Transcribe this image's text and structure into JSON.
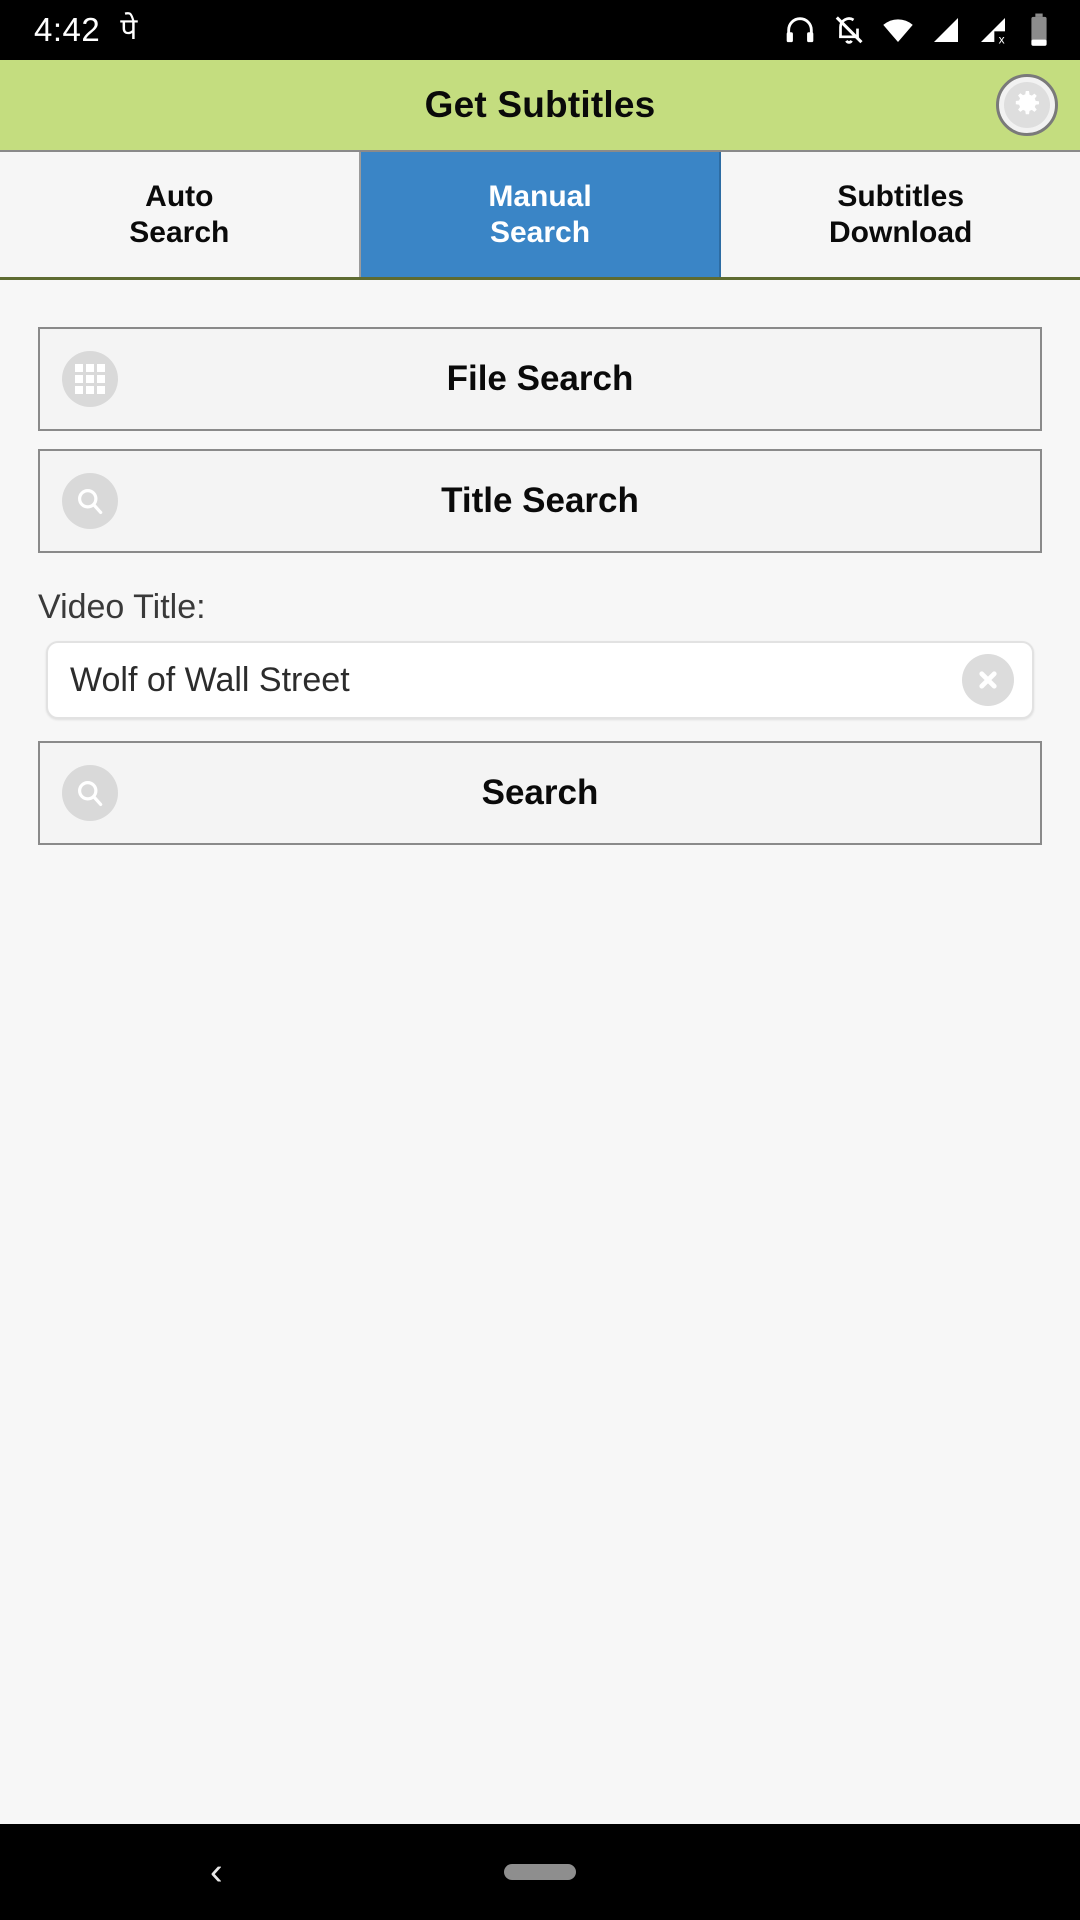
{
  "status_bar": {
    "clock": "4:42",
    "ime_glyph": "पे",
    "icons": [
      {
        "name": "headphones-icon"
      },
      {
        "name": "notifications-off-icon"
      },
      {
        "name": "wifi-icon"
      },
      {
        "name": "signal-bar-icon"
      },
      {
        "name": "signal-no-sim-icon"
      },
      {
        "name": "battery-icon"
      }
    ]
  },
  "header": {
    "title": "Get Subtitles",
    "background_color": "#c4dd7f",
    "settings_icon": "gear-icon"
  },
  "tabs": [
    {
      "line1": "Auto",
      "line2": "Search",
      "active": false
    },
    {
      "line1": "Manual",
      "line2": "Search",
      "active": true
    },
    {
      "line1": "Subtitles",
      "line2": "Download",
      "active": false
    }
  ],
  "tab_active_color": "#3a85c6",
  "main": {
    "file_search_label": "File Search",
    "file_search_icon": "grid-icon",
    "title_search_label": "Title Search",
    "title_search_icon": "search-icon",
    "video_title_label": "Video Title:",
    "video_title_value": "Wolf of Wall Street",
    "video_title_placeholder": "Video Title",
    "clear_icon": "clear-circle-icon",
    "search_label": "Search",
    "search_icon": "search-icon"
  },
  "nav_bar": {
    "back_glyph": "‹",
    "home_pill": ""
  }
}
